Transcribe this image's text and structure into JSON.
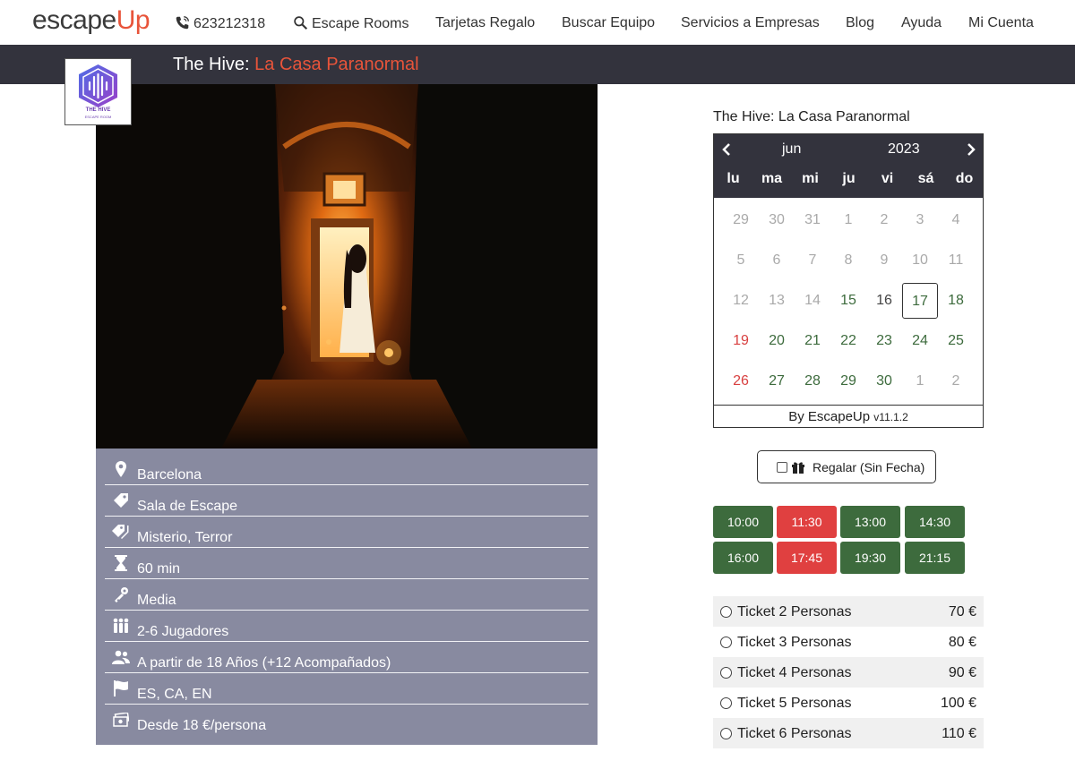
{
  "nav": {
    "logo_part1": "escape",
    "logo_part2": "Up",
    "phone": "623212318",
    "escape_rooms": "Escape Rooms",
    "gift_cards": "Tarjetas Regalo",
    "find_team": "Buscar Equipo",
    "business": "Servicios a Empresas",
    "blog": "Blog",
    "help": "Ayuda",
    "account": "Mi Cuenta"
  },
  "header": {
    "venue": "The Hive:",
    "room": "La Casa Paranormal",
    "thumb_logo_name": "THE HIVE",
    "thumb_logo_sub": "ESCAPE ROOM"
  },
  "info": {
    "location": "Barcelona",
    "category": "Sala de Escape",
    "genres": "Misterio, Terror",
    "duration": "60 min",
    "difficulty": "Media",
    "players": "2-6 Jugadores",
    "age": "A partir de 18 Años (+12 Acompañados)",
    "languages": "ES, CA, EN",
    "price": "Desde 18 €/persona"
  },
  "booking": {
    "title": "The Hive: La Casa Paranormal",
    "month": "jun",
    "year": "2023",
    "dow": [
      "lu",
      "ma",
      "mi",
      "ju",
      "vi",
      "sá",
      "do"
    ],
    "weeks": [
      [
        "29",
        "30",
        "31",
        "1",
        "2",
        "3",
        "4"
      ],
      [
        "5",
        "6",
        "7",
        "8",
        "9",
        "10",
        "11"
      ],
      [
        "12",
        "13",
        "14",
        "15",
        "16",
        "17",
        "18"
      ],
      [
        "19",
        "20",
        "21",
        "22",
        "23",
        "24",
        "25"
      ],
      [
        "26",
        "27",
        "28",
        "29",
        "30",
        "1",
        "2"
      ]
    ],
    "footer_text": "By EscapeUp",
    "footer_version": "v11.1.2",
    "gift_label": "Regalar (Sin Fecha)",
    "slots": [
      "10:00",
      "11:30",
      "13:00",
      "14:30",
      "16:00",
      "17:45",
      "19:30",
      "21:15"
    ],
    "tickets": [
      {
        "name": "Ticket 2 Personas",
        "price": "70 €"
      },
      {
        "name": "Ticket 3 Personas",
        "price": "80 €"
      },
      {
        "name": "Ticket 4 Personas",
        "price": "90 €"
      },
      {
        "name": "Ticket 5 Personas",
        "price": "100 €"
      },
      {
        "name": "Ticket 6 Personas",
        "price": "110 €"
      }
    ]
  },
  "colors": {
    "brand_orange": "#e8543a",
    "header_dark": "#33333d",
    "info_bg": "#888aa0",
    "available_green": "#3d6b3d",
    "full_red": "#e04040"
  }
}
